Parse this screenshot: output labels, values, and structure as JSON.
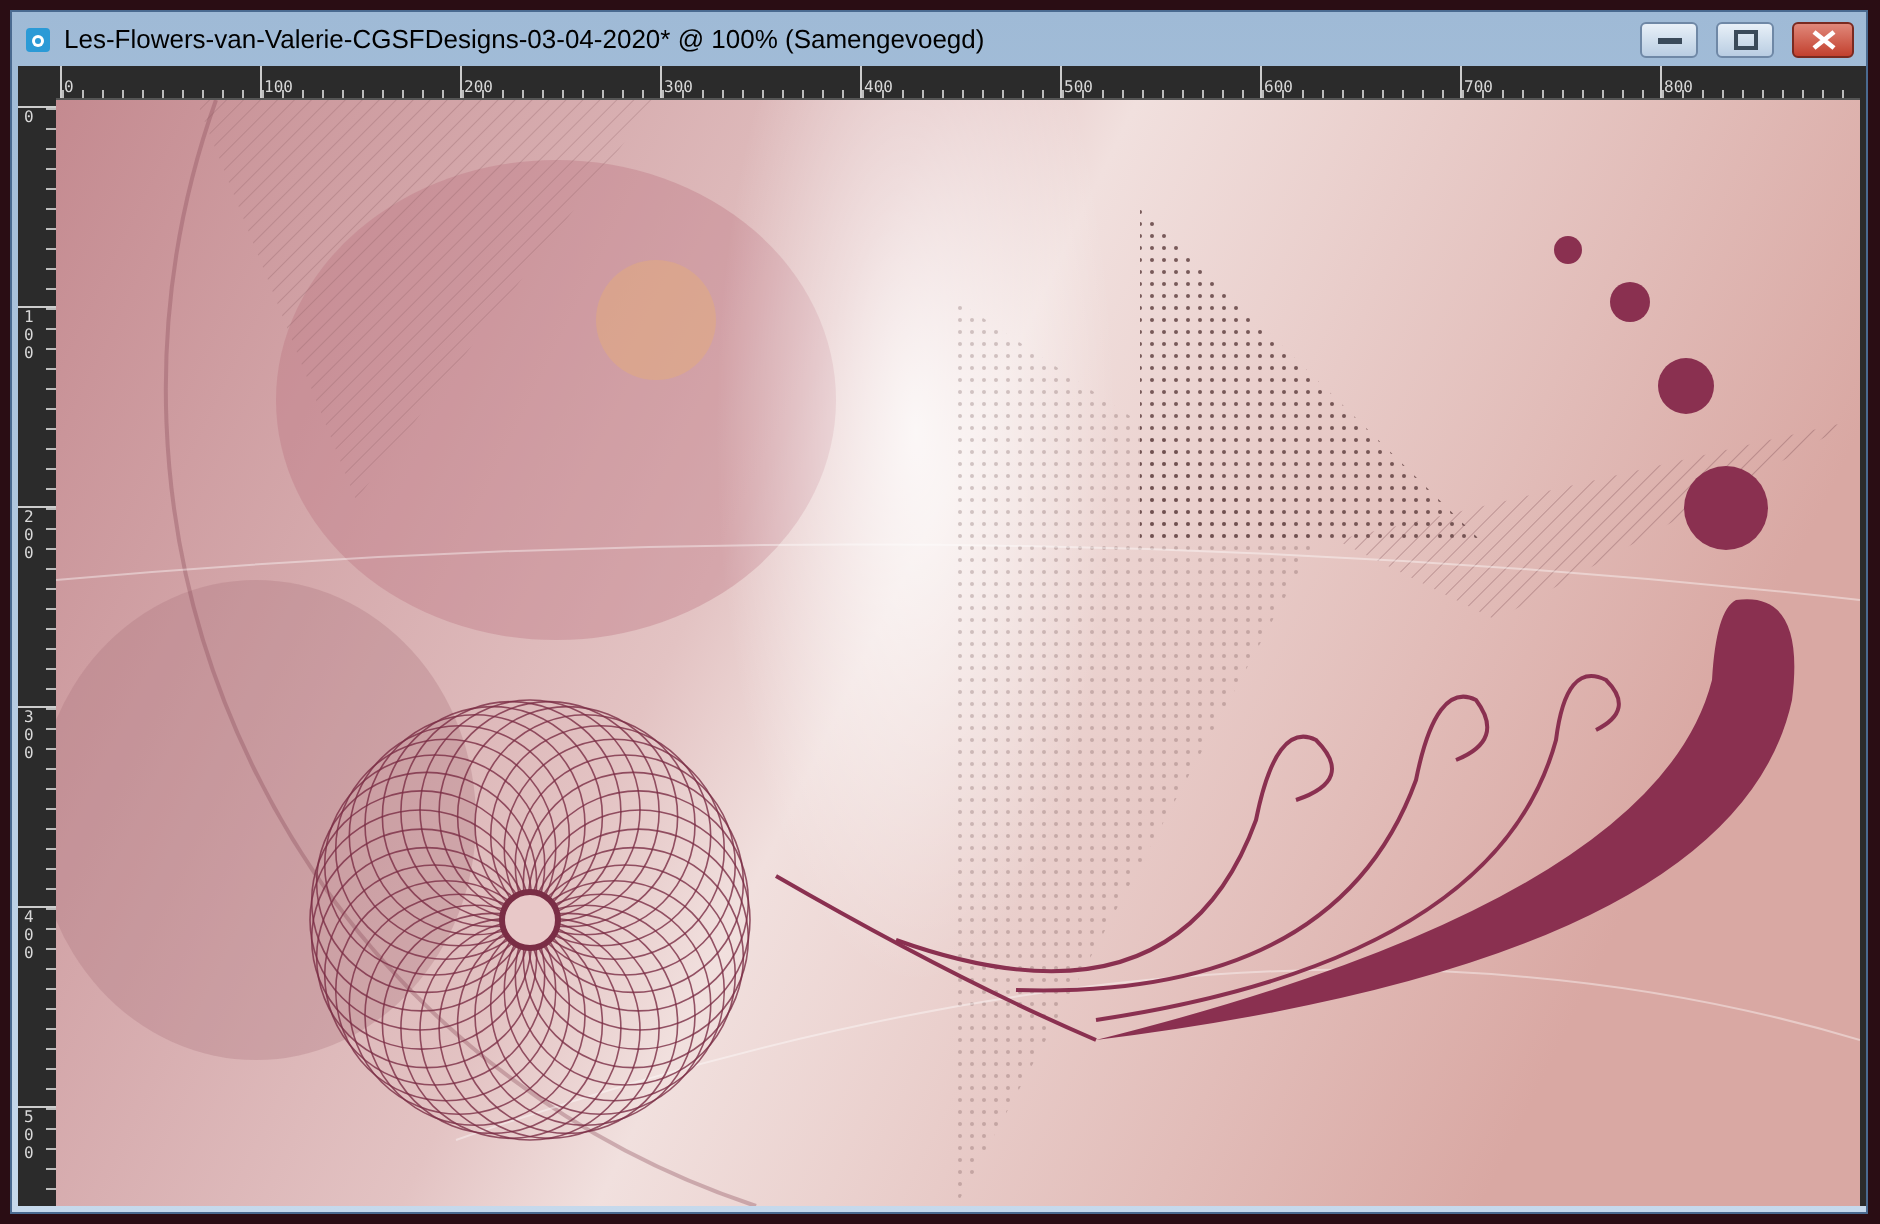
{
  "window": {
    "title": "Les-Flowers-van-Valerie-CGSFDesigns-03-04-2020* @ 100% (Samengevoegd)"
  },
  "rulers": {
    "horizontal": [
      "0",
      "100",
      "200",
      "300",
      "400",
      "500",
      "600",
      "700",
      "800"
    ],
    "vertical": [
      "0",
      "100",
      "200",
      "300",
      "400",
      "500"
    ]
  }
}
